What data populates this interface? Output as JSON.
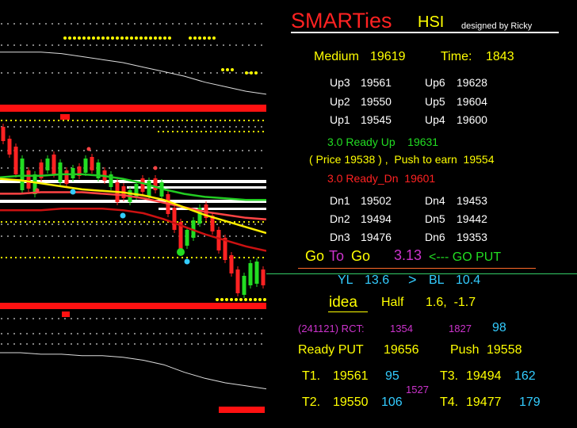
{
  "header": {
    "title": "SMARTies",
    "symbol": "HSI",
    "credit": "designed by Ricky"
  },
  "summary": {
    "medium_label": "Medium",
    "medium_value": "19619",
    "time_label": "Time:",
    "time_value": "1843"
  },
  "levels_up": [
    {
      "left_label": "Up3",
      "left_value": "19561",
      "right_label": "Up6",
      "right_value": "19628"
    },
    {
      "left_label": "Up2",
      "left_value": "19550",
      "right_label": "Up5",
      "right_value": "19604"
    },
    {
      "left_label": "Up1",
      "left_value": "19545",
      "right_label": "Up4",
      "right_value": "19600"
    }
  ],
  "ready": {
    "ready_up": "3.0 Ready Up    19631",
    "price_line": "( Price 19538 ) ,  Push to earn  19554",
    "ready_dn": "3.0 Ready_Dn  19601"
  },
  "levels_dn": [
    {
      "left_label": "Dn1",
      "left_value": "19502",
      "right_label": "Dn4",
      "right_value": "19453"
    },
    {
      "left_label": "Dn2",
      "left_value": "19494",
      "right_label": "Dn5",
      "right_value": "19442"
    },
    {
      "left_label": "Dn3",
      "left_value": "19476",
      "right_label": "Dn6",
      "right_value": "19353"
    }
  ],
  "signal": {
    "go1": "Go",
    "to": "To",
    "go2": "Go",
    "value": "3.13",
    "action": "<--- GO PUT"
  },
  "yl_bl": {
    "yl_label": "YL",
    "yl_value": "13.6",
    "gt": ">",
    "bl_label": "BL",
    "bl_value": "10.4"
  },
  "idea": {
    "label": "idea",
    "half_label": "Half",
    "half_values": "1.6,  -1.7"
  },
  "rct": {
    "date": "(241121) RCT:",
    "v1": "1354",
    "v2": "1827",
    "v3": "98"
  },
  "ready_put": {
    "label": "Ready PUT",
    "value": "19656",
    "push_label": "Push",
    "push_value": "19558"
  },
  "targets": {
    "t1_label": "T1.",
    "t1_value": "19561",
    "t1_pts": "95",
    "t3_label": "T3.",
    "t3_value": "19494",
    "t3_pts": "162",
    "t2_label": "T2.",
    "t2_value": "19550",
    "t2_pts": "106",
    "t4_label": "T4.",
    "t4_value": "19477",
    "t4_pts": "179",
    "mid": "1527"
  },
  "colors": {
    "background": "#000000",
    "title": "#ff2222",
    "accent_yellow": "#ffff00",
    "accent_cyan": "#33ccff",
    "accent_magenta": "#cc33cc",
    "accent_green": "#22dd22"
  },
  "chart_data": {
    "type": "line",
    "series": [
      {
        "values": [
          3,
          3,
          3,
          4,
          6,
          8,
          10,
          13,
          16,
          19,
          23,
          26,
          29,
          31
        ]
      },
      {
        "values": [
          23,
          22,
          22,
          21,
          21,
          22,
          24,
          27,
          31,
          34,
          36,
          37,
          38,
          38
        ]
      },
      {
        "values": [
          26,
          26,
          25,
          25,
          25,
          26,
          27,
          29,
          32,
          35,
          38,
          40,
          42,
          43
        ]
      },
      {
        "values": [
          28,
          28,
          28,
          27,
          27,
          27,
          28,
          30,
          34,
          39,
          44,
          48,
          52,
          55
        ]
      },
      {
        "values": [
          24,
          25,
          27,
          29,
          31,
          32,
          33,
          35,
          38,
          43,
          48,
          52,
          56,
          60
        ]
      },
      {
        "values": [
          50,
          50,
          51,
          51,
          52,
          52,
          53,
          55,
          58,
          63,
          67,
          70,
          72,
          74
        ]
      }
    ]
  }
}
